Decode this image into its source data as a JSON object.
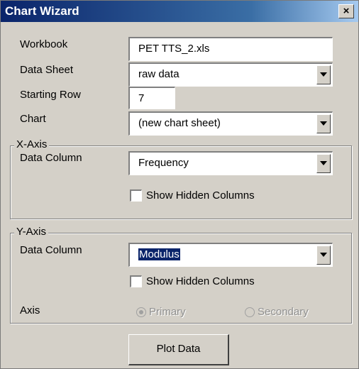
{
  "window": {
    "title": "Chart Wizard",
    "close_symbol": "×"
  },
  "workbook": {
    "label": "Workbook",
    "value": "PET TTS_2.xls"
  },
  "data_sheet": {
    "label": "Data Sheet",
    "value": "raw data"
  },
  "starting_row": {
    "label": "Starting Row",
    "value": "7"
  },
  "chart": {
    "label": "Chart",
    "value": "(new chart sheet)"
  },
  "x_axis": {
    "group_label": "X-Axis",
    "data_column_label": "Data Column",
    "data_column_value": "Frequency",
    "show_hidden_label": "Show Hidden Columns",
    "show_hidden_checked": false
  },
  "y_axis": {
    "group_label": "Y-Axis",
    "data_column_label": "Data Column",
    "data_column_value": "Modulus",
    "show_hidden_label": "Show Hidden Columns",
    "show_hidden_checked": false,
    "axis_label": "Axis",
    "primary_label": "Primary",
    "secondary_label": "Secondary",
    "selected_axis": "Primary"
  },
  "plot_button": {
    "label": "Plot Data"
  }
}
